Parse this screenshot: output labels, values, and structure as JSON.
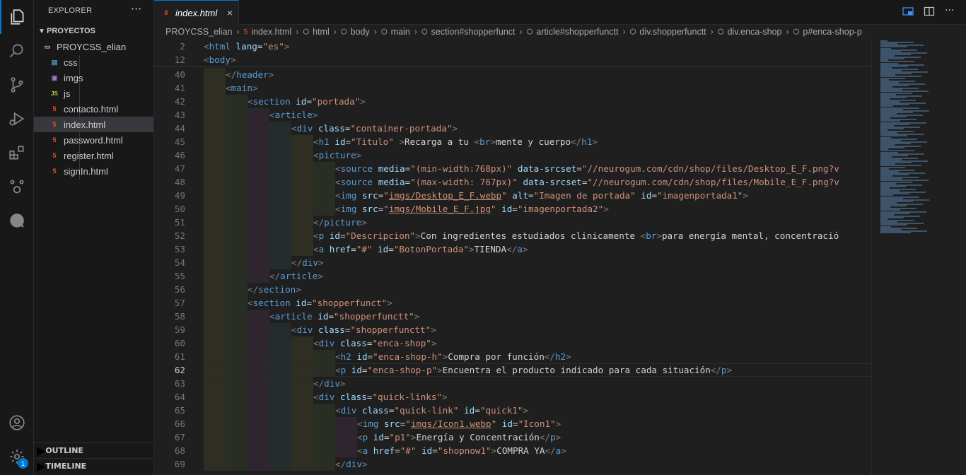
{
  "sidebar": {
    "title": "EXPLORER",
    "more": "···",
    "section": "PROYECTOS",
    "folder": "PROYCSS_elian",
    "items": [
      {
        "label": "css",
        "type": "css"
      },
      {
        "label": "imgs",
        "type": "img"
      },
      {
        "label": "js",
        "type": "js"
      },
      {
        "label": "contacto.html",
        "type": "html"
      },
      {
        "label": "index.html",
        "type": "html",
        "selected": true
      },
      {
        "label": "password.html",
        "type": "html"
      },
      {
        "label": "register.html",
        "type": "html"
      },
      {
        "label": "signIn.html",
        "type": "html"
      }
    ],
    "outline": "OUTLINE",
    "timeline": "TIMELINE"
  },
  "activity": {
    "badge": "1"
  },
  "tab": {
    "label": "index.html",
    "close": "×"
  },
  "breadcrumbs": [
    "PROYCSS_elian",
    "index.html",
    "html",
    "body",
    "main",
    "section#shopperfunct",
    "article#shopperfunctt",
    "div.shopperfunctt",
    "div.enca-shop",
    "p#enca-shop-p"
  ],
  "sticky": [
    {
      "n": "2",
      "html": "<span class='p'>&lt;</span><span class='t'>html</span> <span class='a'>lang</span>=<span class='s'>\"es\"</span><span class='p'>&gt;</span>"
    },
    {
      "n": "12",
      "html": "<span class='p'>&lt;</span><span class='t'>body</span><span class='p'>&gt;</span>"
    }
  ],
  "lines": [
    {
      "n": "40",
      "i": 1,
      "html": "<span class='p'>&lt;/</span><span class='t'>header</span><span class='p'>&gt;</span>"
    },
    {
      "n": "41",
      "i": 1,
      "html": "<span class='p'>&lt;</span><span class='t'>main</span><span class='p'>&gt;</span>"
    },
    {
      "n": "42",
      "i": 2,
      "html": "<span class='p'>&lt;</span><span class='t'>section</span> <span class='a'>id</span>=<span class='s'>\"portada\"</span><span class='p'>&gt;</span>"
    },
    {
      "n": "43",
      "i": 3,
      "html": "<span class='p'>&lt;</span><span class='t'>article</span><span class='p'>&gt;</span>"
    },
    {
      "n": "44",
      "i": 4,
      "html": "<span class='p'>&lt;</span><span class='t'>div</span> <span class='a'>class</span>=<span class='s'>\"container-portada\"</span><span class='p'>&gt;</span>"
    },
    {
      "n": "45",
      "i": 5,
      "html": "<span class='p'>&lt;</span><span class='t'>h1</span> <span class='a'>id</span>=<span class='s'>\"Titulo\"</span> <span class='p'>&gt;</span><span class='tx'>Recarga a tu </span><span class='p'>&lt;</span><span class='t'>br</span><span class='p'>&gt;</span><span class='tx'>mente y cuerpo</span><span class='p'>&lt;/</span><span class='t'>h1</span><span class='p'>&gt;</span>"
    },
    {
      "n": "46",
      "i": 5,
      "html": "<span class='p'>&lt;</span><span class='t'>picture</span><span class='p'>&gt;</span>"
    },
    {
      "n": "47",
      "i": 6,
      "html": "<span class='p'>&lt;</span><span class='t'>source</span> <span class='a'>media</span>=<span class='s'>\"(min-width:768px)\"</span> <span class='a'>data-srcset</span>=<span class='s'>\"//neurogum.com/cdn/shop/files/Desktop_E_F.png?v</span>"
    },
    {
      "n": "48",
      "i": 6,
      "html": "<span class='p'>&lt;</span><span class='t'>source</span> <span class='a'>media</span>=<span class='s'>\"(max-width: 767px)\"</span> <span class='a'>data-srcset</span>=<span class='s'>\"//neurogum.com/cdn/shop/files/Mobile_E_F.png?v</span>"
    },
    {
      "n": "49",
      "i": 6,
      "html": "<span class='p'>&lt;</span><span class='t'>img</span> <span class='a'>src</span>=<span class='s'>\"<span class='u'>imgs/Desktop_E_F.webp</span>\"</span> <span class='a'>alt</span>=<span class='s'>\"Imagen de portada\"</span> <span class='a'>id</span>=<span class='s'>\"imagenportada1\"</span><span class='p'>&gt;</span>"
    },
    {
      "n": "50",
      "i": 6,
      "html": "<span class='p'>&lt;</span><span class='t'>img</span> <span class='a'>src</span>=<span class='s'>\"<span class='u'>imgs/Mobile_E_F.jpg</span>\"</span> <span class='a'>id</span>=<span class='s'>\"imagenportada2\"</span><span class='p'>&gt;</span>"
    },
    {
      "n": "51",
      "i": 5,
      "html": "<span class='p'>&lt;/</span><span class='t'>picture</span><span class='p'>&gt;</span>"
    },
    {
      "n": "52",
      "i": 5,
      "html": "<span class='p'>&lt;</span><span class='t'>p</span> <span class='a'>id</span>=<span class='s'>\"Descripcion\"</span><span class='p'>&gt;</span><span class='tx'>Con ingredientes estudiados clinicamente </span><span class='p'>&lt;</span><span class='t'>br</span><span class='p'>&gt;</span><span class='tx'>para energía mental, concentració</span>"
    },
    {
      "n": "53",
      "i": 5,
      "html": "<span class='p'>&lt;</span><span class='t'>a</span> <span class='a'>href</span>=<span class='s'>\"#\"</span> <span class='a'>id</span>=<span class='s'>\"BotonPortada\"</span><span class='p'>&gt;</span><span class='tx'>TIENDA</span><span class='p'>&lt;/</span><span class='t'>a</span><span class='p'>&gt;</span>"
    },
    {
      "n": "54",
      "i": 4,
      "html": "<span class='p'>&lt;/</span><span class='t'>div</span><span class='p'>&gt;</span>"
    },
    {
      "n": "55",
      "i": 3,
      "html": "<span class='p'>&lt;/</span><span class='t'>article</span><span class='p'>&gt;</span>"
    },
    {
      "n": "56",
      "i": 2,
      "html": "<span class='p'>&lt;/</span><span class='t'>section</span><span class='p'>&gt;</span>"
    },
    {
      "n": "57",
      "i": 2,
      "html": "<span class='p'>&lt;</span><span class='t'>section</span> <span class='a'>id</span>=<span class='s'>\"shopperfunct\"</span><span class='p'>&gt;</span>"
    },
    {
      "n": "58",
      "i": 3,
      "html": "<span class='p'>&lt;</span><span class='t'>article</span> <span class='a'>id</span>=<span class='s'>\"shopperfunctt\"</span><span class='p'>&gt;</span>"
    },
    {
      "n": "59",
      "i": 4,
      "html": "<span class='p'>&lt;</span><span class='t'>div</span> <span class='a'>class</span>=<span class='s'>\"shopperfunctt\"</span><span class='p'>&gt;</span>"
    },
    {
      "n": "60",
      "i": 5,
      "html": "<span class='p'>&lt;</span><span class='t'>div</span> <span class='a'>class</span>=<span class='s'>\"enca-shop\"</span><span class='p'>&gt;</span>"
    },
    {
      "n": "61",
      "i": 6,
      "html": "<span class='p'>&lt;</span><span class='t'>h2</span> <span class='a'>id</span>=<span class='s'>\"enca-shop-h\"</span><span class='p'>&gt;</span><span class='tx'>Compra por función</span><span class='p'>&lt;/</span><span class='t'>h2</span><span class='p'>&gt;</span>"
    },
    {
      "n": "62",
      "i": 6,
      "cur": true,
      "html": "<span class='p'>&lt;</span><span class='t'>p</span> <span class='a'>id</span>=<span class='s'>\"enca-shop-p\"</span><span class='p'>&gt;</span><span class='tx'>Encuentra el producto indicado para cada situación</span><span class='p'>&lt;/</span><span class='t'>p</span><span class='p'>&gt;</span>"
    },
    {
      "n": "63",
      "i": 5,
      "html": "<span class='p'>&lt;/</span><span class='t'>div</span><span class='p'>&gt;</span>"
    },
    {
      "n": "64",
      "i": 5,
      "html": "<span class='p'>&lt;</span><span class='t'>div</span> <span class='a'>class</span>=<span class='s'>\"quick-links\"</span><span class='p'>&gt;</span>"
    },
    {
      "n": "65",
      "i": 6,
      "html": "<span class='p'>&lt;</span><span class='t'>div</span> <span class='a'>class</span>=<span class='s'>\"quick-link\"</span> <span class='a'>id</span>=<span class='s'>\"quick1\"</span><span class='p'>&gt;</span>"
    },
    {
      "n": "66",
      "i": 7,
      "html": "<span class='p'>&lt;</span><span class='t'>img</span> <span class='a'>src</span>=<span class='s'>\"<span class='u'>imgs/Icon1.webp</span>\"</span> <span class='a'>id</span>=<span class='s'>\"Icon1\"</span><span class='p'>&gt;</span>"
    },
    {
      "n": "67",
      "i": 7,
      "html": "<span class='p'>&lt;</span><span class='t'>p</span> <span class='a'>id</span>=<span class='s'>\"p1\"</span><span class='p'>&gt;</span><span class='tx'>Energía y Concentración</span><span class='p'>&lt;/</span><span class='t'>p</span><span class='p'>&gt;</span>"
    },
    {
      "n": "68",
      "i": 7,
      "html": "<span class='p'>&lt;</span><span class='t'>a</span> <span class='a'>href</span>=<span class='s'>\"#\"</span> <span class='a'>id</span>=<span class='s'>\"shopnow1\"</span><span class='p'>&gt;</span><span class='tx'>COMPRA YA</span><span class='p'>&lt;/</span><span class='t'>a</span><span class='p'>&gt;</span>"
    },
    {
      "n": "69",
      "i": 6,
      "html": "<span class='p'>&lt;/</span><span class='t'>div</span><span class='p'>&gt;</span>"
    }
  ],
  "colors": {
    "accent": "#0078d4",
    "html_icon": "#e44d26"
  }
}
